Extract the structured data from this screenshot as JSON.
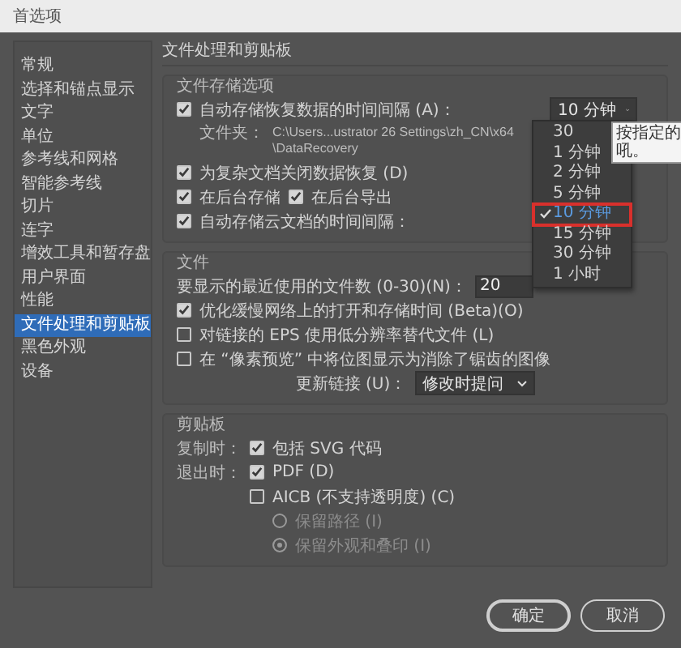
{
  "window": {
    "title": "首选项"
  },
  "sidebar": {
    "items": [
      {
        "label": "常规",
        "selected": false
      },
      {
        "label": "选择和锚点显示",
        "selected": false
      },
      {
        "label": "文字",
        "selected": false
      },
      {
        "label": "单位",
        "selected": false
      },
      {
        "label": "参考线和网格",
        "selected": false
      },
      {
        "label": "智能参考线",
        "selected": false
      },
      {
        "label": "切片",
        "selected": false
      },
      {
        "label": "连字",
        "selected": false
      },
      {
        "label": "增效工具和暂存盘",
        "selected": false
      },
      {
        "label": "用户界面",
        "selected": false
      },
      {
        "label": "性能",
        "selected": false
      },
      {
        "label": "文件处理和剪贴板",
        "selected": true
      },
      {
        "label": "黑色外观",
        "selected": false
      },
      {
        "label": "设备",
        "selected": false
      }
    ]
  },
  "panel": {
    "title": "文件处理和剪贴板"
  },
  "sections": [
    {
      "title": "文件存储选项",
      "rows": [
        {
          "kind": "checkbox",
          "label": "自动存储恢复数据的时间间隔 (A)：",
          "checked": true,
          "dropdown": "10 分钟"
        },
        {
          "kind": "path",
          "label": "文件夹：",
          "value": "C:\\Users...ustrator 26 Settings\\zh_CN\\x64\\DataRecovery"
        },
        {
          "kind": "checkbox",
          "label": "为复杂文档关闭数据恢复 (D)",
          "checked": true
        },
        {
          "kind": "pair",
          "items": [
            {
              "label": "在后台存储",
              "checked": true
            },
            {
              "label": "在后台导出",
              "checked": true
            }
          ]
        },
        {
          "kind": "checkbox",
          "label": "自动存储云文档的时间间隔：",
          "checked": true
        }
      ]
    },
    {
      "title": "文件",
      "rows": [
        {
          "kind": "number",
          "label": "要显示的最近使用的文件数 (0-30)(N)：",
          "value": "20"
        },
        {
          "kind": "checkbox",
          "label": "优化缓慢网络上的打开和存储时间 (Beta)(O)",
          "checked": true
        },
        {
          "kind": "checkbox",
          "label": "对链接的 EPS 使用低分辨率替代文件 (L)",
          "checked": false
        },
        {
          "kind": "checkbox",
          "label": "在 “像素预览” 中将位图显示为消除了锯齿的图像",
          "checked": false
        },
        {
          "kind": "select",
          "label": "更新链接 (U)：",
          "value": "修改时提问"
        }
      ]
    },
    {
      "title": "剪贴板",
      "rows": [
        {
          "kind": "checkbox",
          "prefix": "复制时：",
          "label": "包括 SVG 代码",
          "checked": true
        },
        {
          "kind": "checkbox",
          "prefix": "退出时：",
          "label": "PDF (D)",
          "checked": true
        },
        {
          "kind": "sub_checkbox",
          "label": "AICB (不支持透明度) (C)",
          "checked": false
        },
        {
          "kind": "radio",
          "label": "保留路径 (I)",
          "selected": false,
          "disabled": true
        },
        {
          "kind": "radio",
          "label": "保留外观和叠印 (I)",
          "selected": true,
          "disabled": true
        }
      ]
    }
  ],
  "dropdown_menu": {
    "items": [
      {
        "label": "30",
        "selected": false
      },
      {
        "label": "1 分钟",
        "selected": false
      },
      {
        "label": "2 分钟",
        "selected": false
      },
      {
        "label": "5 分钟",
        "selected": false
      },
      {
        "label": "10 分钟",
        "selected": true
      },
      {
        "label": "15 分钟",
        "selected": false
      },
      {
        "label": "30 分钟",
        "selected": false
      },
      {
        "label": "1 小时",
        "selected": false
      }
    ]
  },
  "tooltip": {
    "lines": [
      "按指定的",
      "吼。"
    ]
  },
  "buttons": [
    {
      "label": "确定",
      "kind": "default"
    },
    {
      "label": "取消",
      "kind": "normal"
    }
  ]
}
